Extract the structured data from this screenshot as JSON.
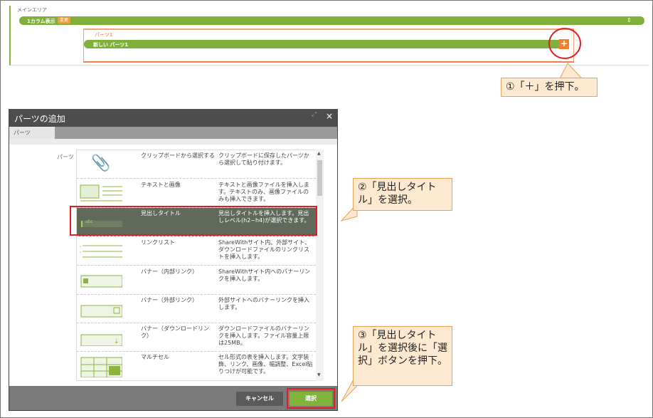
{
  "editor": {
    "main_area_label": "メインエリア",
    "column_label": "1カラム表示",
    "column_badge": "変更",
    "column_arrows": "⇕",
    "part_label": "パーツ1",
    "part_bar_label": "新しい パーツ1",
    "plus": "+"
  },
  "callouts": {
    "step1": "①「＋」を押下。",
    "step2": "②「見出しタイトル」を選択。",
    "step3": "③「見出しタイトル」を選択後に「選択」ボタンを押下。"
  },
  "dialog": {
    "title": "パーツの追加",
    "close": "×",
    "tab": "パーツ",
    "section_label": "パーツ",
    "items": [
      {
        "name": "クリップボードから選択する",
        "desc": "クリップボードに保存したパーツから選択して貼り付けます。",
        "icon": "paperclip-icon"
      },
      {
        "name": "テキストと画像",
        "desc": "テキストと画像ファイルを挿入します。テキストのみ、画像ファイルのみも挿入できます。",
        "icon": "text-image-icon"
      },
      {
        "name": "見出しタイトル",
        "desc": "見出しタイトルを挿入します。見出しレベル(h2~h4)が選択できます。",
        "icon": "heading-icon",
        "thumb_text": "abc"
      },
      {
        "name": "リンクリスト",
        "desc": "ShareWithサイト内、外部サイト、ダウンロードファイルのリンクリストを挿入します。",
        "icon": "link-list-icon"
      },
      {
        "name": "バナー（内部リンク）",
        "desc": "ShareWithサイト内へのバナーリンクを挿入します。",
        "icon": "banner-internal-icon"
      },
      {
        "name": "バナー（外部リンク）",
        "desc": "外部サイトへのバナーリンクを挿入します。",
        "icon": "banner-external-icon"
      },
      {
        "name": "バナー（ダウンロードリンク）",
        "desc": "ダウンロードファイルのバナーリンクを挿入します。ファイル容量上限は25MB。",
        "icon": "banner-download-icon"
      },
      {
        "name": "マルチセル",
        "desc": "セル形式の表を挿入します。文字装飾、リンク、画像、幅調整、Excel貼りつけが可能です。",
        "icon": "multicell-icon"
      }
    ],
    "cancel_label": "キャンセル",
    "select_label": "選択"
  },
  "colors": {
    "accent_green": "#7fb13a",
    "highlight_red": "#e02020",
    "callout_bg": "#fde9cf"
  }
}
